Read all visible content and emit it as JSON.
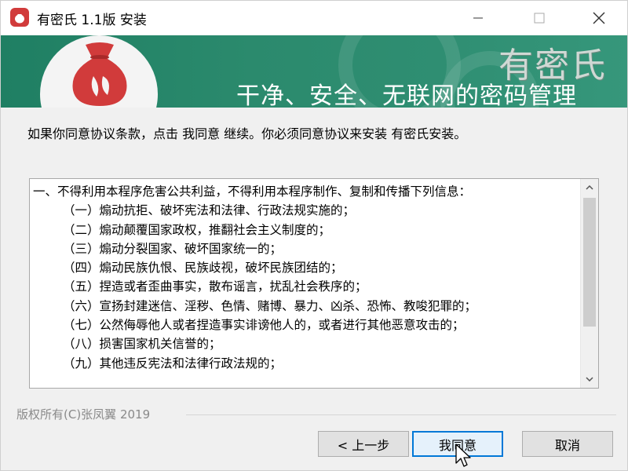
{
  "window": {
    "title": "有密氏 1.1版 安装",
    "controls": [
      "minimize",
      "maximize",
      "close"
    ]
  },
  "banner": {
    "brand": "有密氏",
    "slogan": "干净、安全、无联网的密码管理",
    "colors": {
      "background": "#2b8a6d",
      "bag": "#d13b3b"
    }
  },
  "instruction": "如果你同意协议条款，点击 我同意 继续。你必须同意协议来安装 有密氏安装。",
  "license": {
    "paragraph": "一、不得利用本程序危害公共利益，不得利用本程序制作、复制和传播下列信息：",
    "items": [
      "（一）煽动抗拒、破坏宪法和法律、行政法规实施的；",
      "（二）煽动颠覆国家政权，推翻社会主义制度的；",
      "（三）煽动分裂国家、破坏国家统一的；",
      "（四）煽动民族仇恨、民族歧视，破坏民族团结的；",
      "（五）捏造或者歪曲事实，散布谣言，扰乱社会秩序的；",
      "（六）宣扬封建迷信、淫秽、色情、赌博、暴力、凶杀、恐怖、教唆犯罪的；",
      "（七）公然侮辱他人或者捏造事实诽谤他人的，或者进行其他恶意攻击的；",
      "（八）损害国家机关信誉的；",
      "（九）其他违反宪法和法律行政法规的；"
    ]
  },
  "footer": {
    "copyright": "版权所有(C)张凤翼 2019",
    "buttons": {
      "back": "< 上一步",
      "agree": "我同意",
      "cancel": "取消"
    }
  }
}
